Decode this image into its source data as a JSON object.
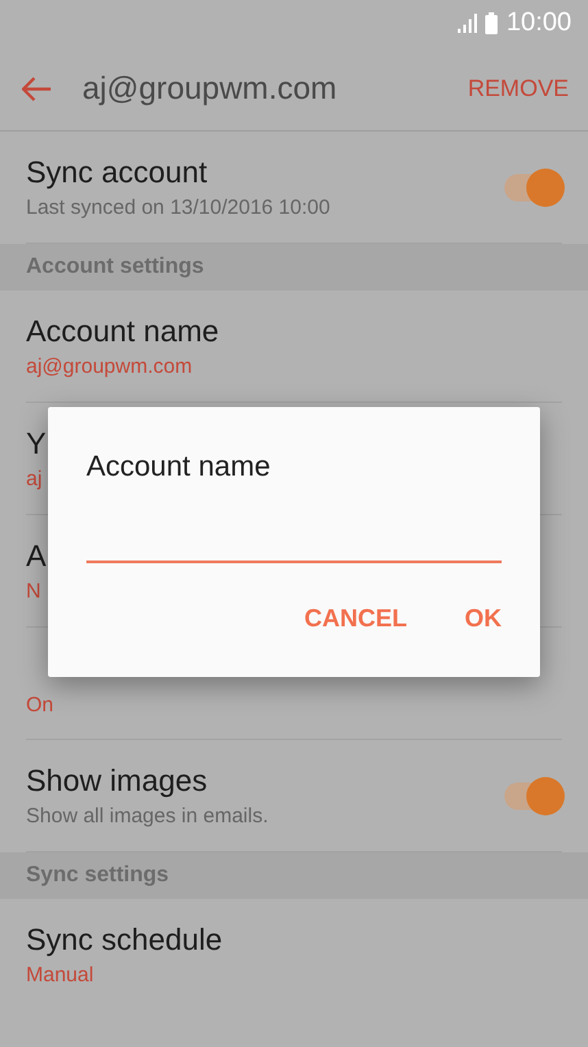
{
  "status_bar": {
    "time": "10:00"
  },
  "toolbar": {
    "title": "aj@groupwm.com",
    "action": "REMOVE"
  },
  "items": [
    {
      "kind": "toggle",
      "title": "Sync account",
      "subtitle": "Last synced on 13/10/2016  10:00",
      "on": true
    },
    {
      "kind": "header",
      "title": "Account settings"
    },
    {
      "kind": "value",
      "title": "Account name",
      "subtitle": "aj@groupwm.com"
    },
    {
      "kind": "value",
      "title": "Y",
      "subtitle": "aj"
    },
    {
      "kind": "value",
      "title": "A",
      "subtitle": "N"
    },
    {
      "kind": "value",
      "subtitle": "On"
    },
    {
      "kind": "toggle",
      "title": "Show images",
      "subtitle": "Show all images in emails.",
      "on": true
    },
    {
      "kind": "header",
      "title": "Sync settings"
    },
    {
      "kind": "value",
      "title": "Sync schedule",
      "subtitle": "Manual"
    }
  ],
  "dialog": {
    "title": "Account name",
    "buttons": [
      "CANCEL",
      "OK"
    ]
  }
}
